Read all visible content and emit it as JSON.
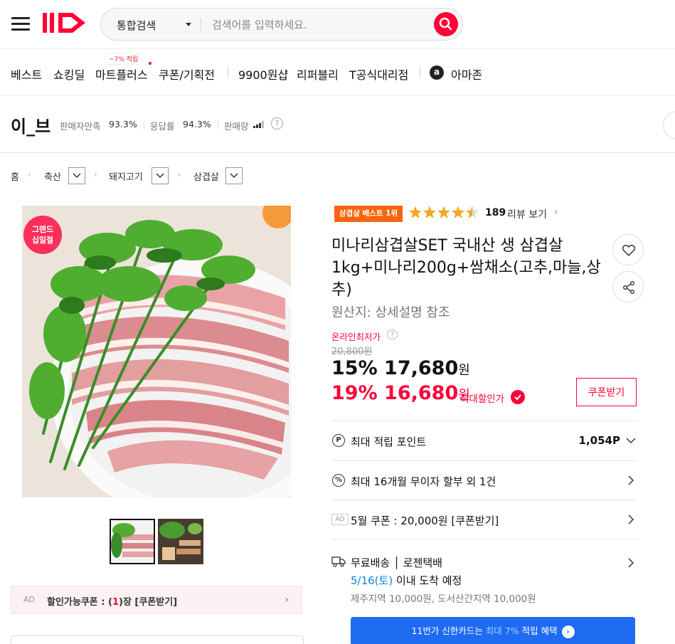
{
  "header": {
    "search_category": "통합검색",
    "search_placeholder": "검색어를 입력하세요."
  },
  "gnb": {
    "items": [
      "베스트",
      "쇼킹딜",
      "마트플러스",
      "쿠폰/기획전",
      "9900원샵",
      "리퍼블리",
      "T공식대리점",
      "아마존"
    ],
    "badge": "~7% 적립"
  },
  "seller": {
    "name": "이_브",
    "satisfaction_label": "판매자만족",
    "satisfaction_value": "93.3%",
    "response_label": "응답률",
    "response_value": "94.3%",
    "sales_label": "판매량",
    "help": "?"
  },
  "breadcrumb": [
    "홈",
    "축산",
    "돼지고기",
    "삼겹살"
  ],
  "gallery": {
    "badge_line1": "그랜드",
    "badge_line2": "십일절"
  },
  "ad_coupon": {
    "ad": "AD",
    "prefix": "할인가능쿠폰 : (",
    "count": "1",
    "suffix": ")장 [쿠폰받기]"
  },
  "product": {
    "best_badge": "삼겹살 베스트 1위",
    "rating": 4.5,
    "review_count": "189",
    "review_link": "리뷰 보기",
    "title": "미나리삼겹살SET 국내산 생 삼겹살1kg+미나리200g+쌈채소(고추,마늘,상추)",
    "origin": "원산지: 상세설명 참조",
    "online_low": "온라인최저가",
    "original_price": "20,800원",
    "discount1": "15%",
    "price1": "17,680",
    "discount2": "19%",
    "price2": "16,680",
    "unit": "원",
    "max_sale": "최대할인가",
    "coupon_button": "쿠폰받기"
  },
  "benefits": {
    "points_label": "최대 적립 포인트",
    "points_value": "1,054P",
    "installment": "최대 16개월 무이자 할부 외 1건",
    "ad": "AD",
    "coupon": "5월 쿠폰 : 20,000원 [쿠폰받기]",
    "shipping": "무료배송 │ 로젠택배",
    "arrival_date": "5/16(토)",
    "arrival_text": " 이내 도착 예정",
    "shipping_extra": "제주지역 10,000원, 도서산간지역 10,000원"
  },
  "card_banner": {
    "prefix": "11번가 신한카드는 ",
    "highlight": "최대 7%",
    "suffix": " 적립 혜택"
  },
  "colors": {
    "brand": "#ff0038",
    "orange": "#f8650f",
    "blue": "#1f6bf2"
  }
}
